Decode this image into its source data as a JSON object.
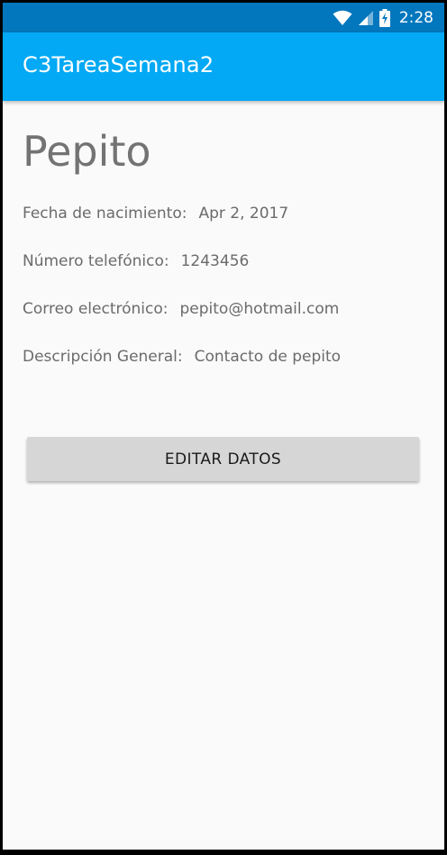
{
  "status_bar": {
    "time": "2:28",
    "icons": [
      "wifi-icon",
      "signal-icon",
      "battery-charging-icon"
    ]
  },
  "app_bar": {
    "title": "C3TareaSemana2"
  },
  "contact": {
    "name": "Pepito",
    "birth_label": "Fecha de nacimiento:",
    "birth_value": "Apr 2, 2017",
    "phone_label": "Número telefónico:",
    "phone_value": "1243456",
    "email_label": "Correo electrónico:",
    "email_value": "pepito@hotmail.com",
    "description_label": "Descripción General:",
    "description_value": "Contacto de pepito"
  },
  "actions": {
    "edit_label": "EDITAR DATOS"
  },
  "colors": {
    "status_bar": "#0277bd",
    "app_bar": "#03a9f4",
    "background": "#fafafa",
    "button": "#d6d6d6"
  }
}
